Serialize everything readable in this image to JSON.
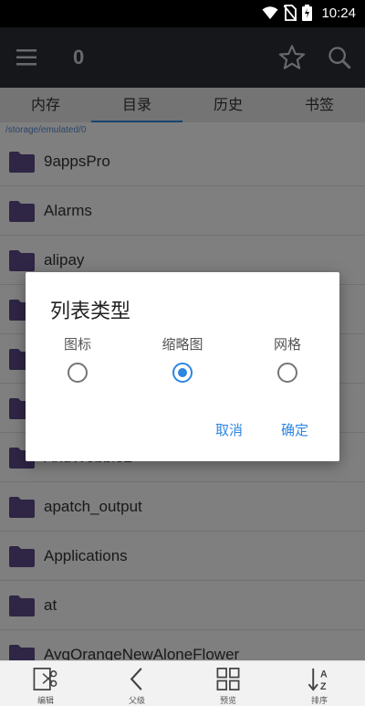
{
  "status_bar": {
    "time": "10:24"
  },
  "app_bar": {
    "title": "0"
  },
  "tabs": [
    {
      "label": "内存"
    },
    {
      "label": "目录"
    },
    {
      "label": "历史"
    },
    {
      "label": "书签"
    }
  ],
  "active_tab": "目录",
  "path": "/storage/emulated/0",
  "files": [
    {
      "name": "9appsPro"
    },
    {
      "name": "Alarms"
    },
    {
      "name": "alipay"
    },
    {
      "name": ""
    },
    {
      "name": ""
    },
    {
      "name": ""
    },
    {
      "name": "AndWobble2"
    },
    {
      "name": "apatch_output"
    },
    {
      "name": "Applications"
    },
    {
      "name": "at"
    },
    {
      "name": "AvgOrangeNewAloneFlower"
    }
  ],
  "dialog": {
    "title": "列表类型",
    "options": [
      {
        "label": "图标",
        "selected": false
      },
      {
        "label": "缩略图",
        "selected": true
      },
      {
        "label": "网格",
        "selected": false
      }
    ],
    "cancel": "取消",
    "confirm": "确定"
  },
  "bottom_bar": [
    {
      "label": "编辑",
      "icon": "edit-cut-icon"
    },
    {
      "label": "父级",
      "icon": "chevron-left-icon"
    },
    {
      "label": "预览",
      "icon": "grid-icon"
    },
    {
      "label": "排序",
      "icon": "sort-az-icon"
    }
  ],
  "colors": {
    "accent": "#2d86e0",
    "app_bar": "#2a2f36",
    "folder": "#5e4b8b"
  }
}
